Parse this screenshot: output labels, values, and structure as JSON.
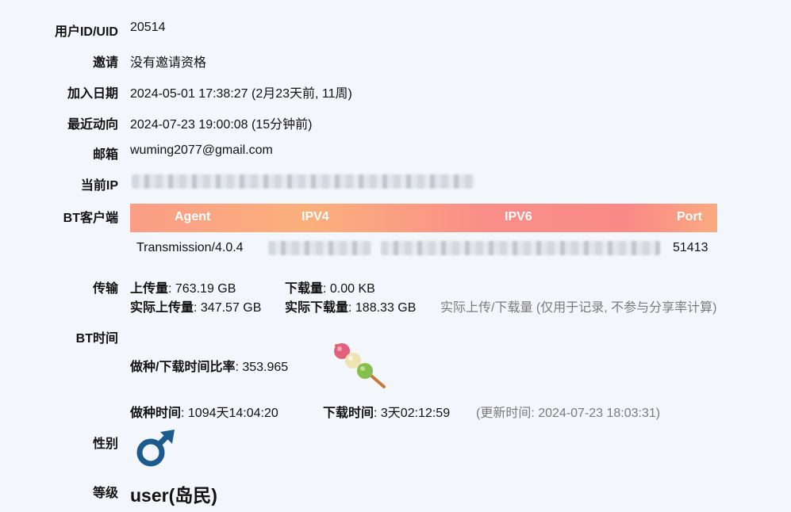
{
  "uid": {
    "label": "用户ID/UID",
    "value": "20514"
  },
  "invite": {
    "label": "邀请",
    "value": "没有邀请资格"
  },
  "join_date": {
    "label": "加入日期",
    "value": "2024-05-01 17:38:27 (2月23天前, 11周)"
  },
  "last_action": {
    "label": "最近动向",
    "value": "2024-07-23 19:00:08 (15分钟前)"
  },
  "email": {
    "label": "邮箱",
    "value": "wuming2077@gmail.com"
  },
  "ip": {
    "label": "当前IP"
  },
  "bt_client": {
    "label": "BT客户端",
    "headers": {
      "agent": "Agent",
      "ipv4": "IPV4",
      "ipv6": "IPV6",
      "port": "Port"
    },
    "row": {
      "agent": "Transmission/4.0.4",
      "port": "51413"
    }
  },
  "transfer": {
    "label": "传输",
    "upload_label": "上传量",
    "upload": ": 763.19 GB",
    "download_label": "下载量",
    "download": ": 0.00 KB",
    "real_upload_label": "实际上传量",
    "real_upload": ": 347.57 GB",
    "real_download_label": "实际下载量",
    "real_download": ": 188.33 GB",
    "note": "实际上传/下载量 (仅用于记录, 不参与分享率计算)"
  },
  "bt_time": {
    "label": "BT时间",
    "ratio_label": "做种/下载时间比率",
    "ratio": ": 353.965",
    "seed_label": "做种时间",
    "seed": ": 1094天14:04:20",
    "dl_label": "下载时间",
    "dl": ": 3天02:12:59",
    "updated": "(更新时间: 2024-07-23 18:03:31)"
  },
  "gender": {
    "label": "性别",
    "icon": "male-icon"
  },
  "level": {
    "label": "等级",
    "value": "user(岛民)"
  }
}
